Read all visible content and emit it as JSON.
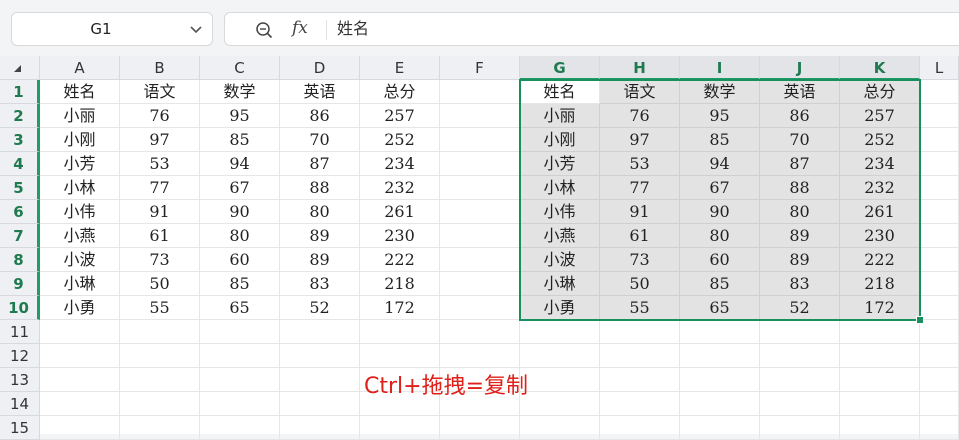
{
  "namebox": {
    "value": "G1"
  },
  "formula_bar": {
    "fx_label": "fx",
    "content": "姓名"
  },
  "columns": [
    "A",
    "B",
    "C",
    "D",
    "E",
    "F",
    "G",
    "H",
    "I",
    "J",
    "K"
  ],
  "partial_column": "L",
  "rows": [
    "1",
    "2",
    "3",
    "4",
    "5",
    "6",
    "7",
    "8",
    "9",
    "10",
    "11",
    "12",
    "13",
    "14",
    "15"
  ],
  "selected_columns": [
    "G",
    "H",
    "I",
    "J",
    "K"
  ],
  "selected_rows": [
    "1",
    "2",
    "3",
    "4",
    "5",
    "6",
    "7",
    "8",
    "9",
    "10"
  ],
  "table": {
    "headers": [
      "姓名",
      "语文",
      "数学",
      "英语",
      "总分"
    ],
    "rows": [
      [
        "小丽",
        "76",
        "95",
        "86",
        "257"
      ],
      [
        "小刚",
        "97",
        "85",
        "70",
        "252"
      ],
      [
        "小芳",
        "53",
        "94",
        "87",
        "234"
      ],
      [
        "小林",
        "77",
        "67",
        "88",
        "232"
      ],
      [
        "小伟",
        "91",
        "90",
        "80",
        "261"
      ],
      [
        "小燕",
        "61",
        "80",
        "89",
        "230"
      ],
      [
        "小波",
        "73",
        "60",
        "89",
        "222"
      ],
      [
        "小琳",
        "50",
        "85",
        "83",
        "218"
      ],
      [
        "小勇",
        "55",
        "65",
        "52",
        "172"
      ]
    ]
  },
  "annotation": "Ctrl+拖拽=复制",
  "colors": {
    "accent": "#1a8f5e",
    "annotation": "#e0201a",
    "shade": "#e3e3e3"
  },
  "icons": {
    "namebox_dropdown": "chevron-down-icon",
    "zoom": "zoom-icon",
    "corner": "select-all-icon"
  }
}
